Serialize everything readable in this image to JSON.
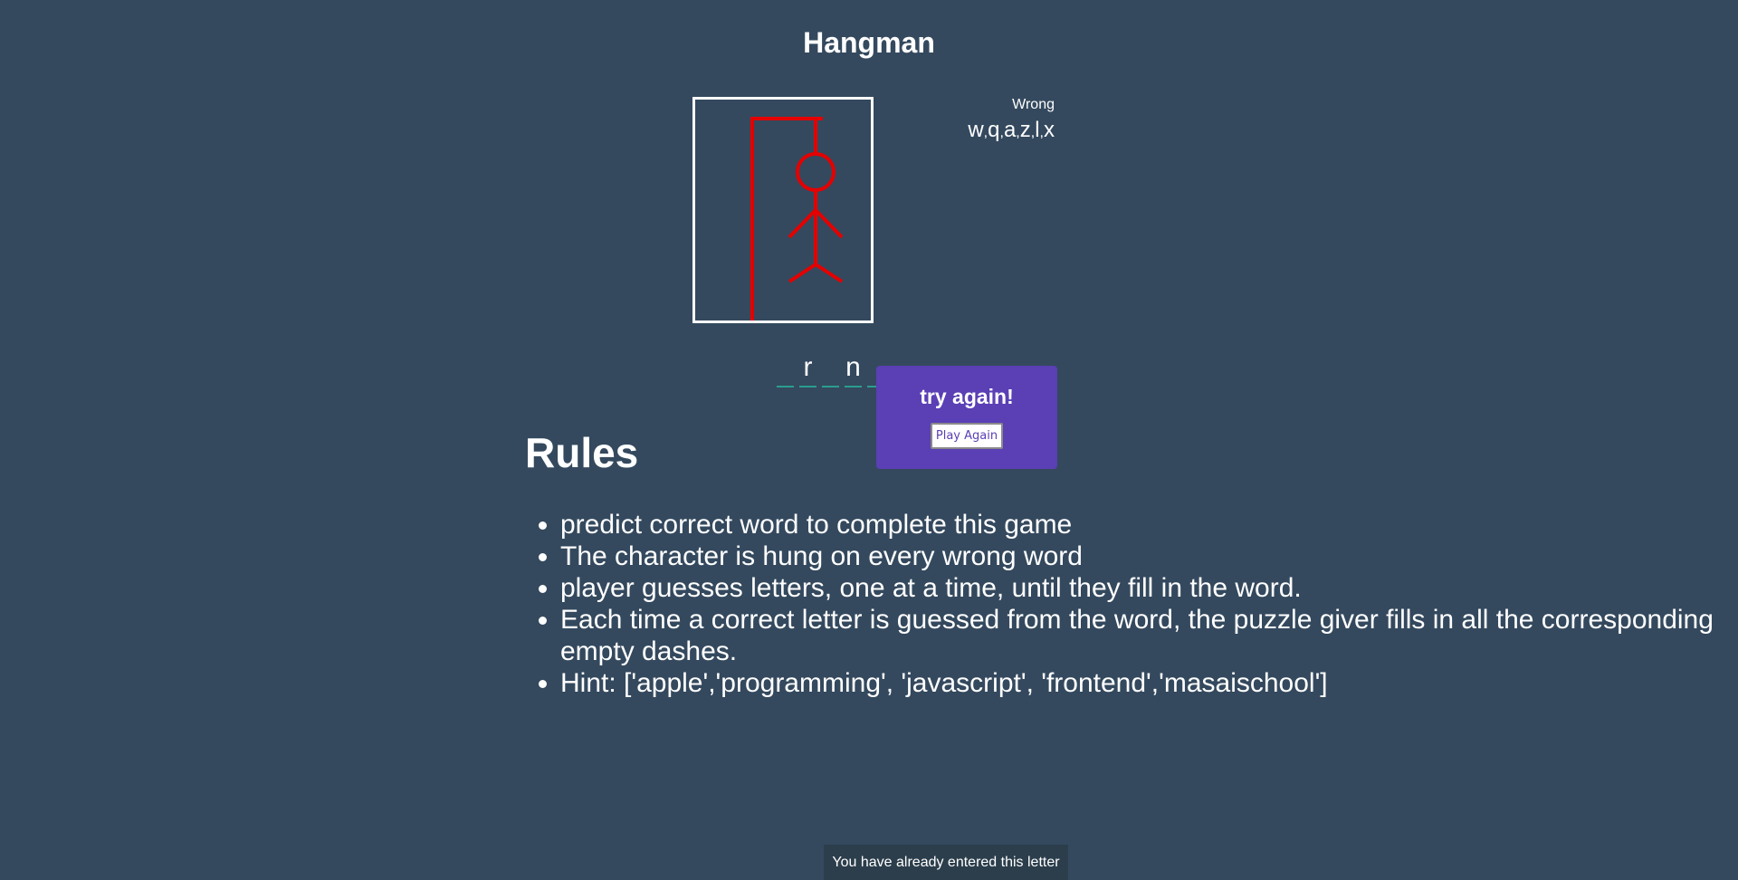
{
  "app": {
    "title": "Hangman"
  },
  "wrong": {
    "title": "Wrong",
    "letters": [
      "w",
      "q",
      "a",
      "z",
      "l",
      "x"
    ],
    "separator": ","
  },
  "word": {
    "slots": [
      "",
      "r",
      "",
      "n",
      "",
      "",
      ""
    ]
  },
  "rules": {
    "heading": "Rules",
    "items": [
      "predict correct word to complete this game",
      "The character is hung on every wrong word",
      "player guesses letters, one at a time, until they fill in the word.",
      "Each time a correct letter is guessed from the word, the puzzle giver fills in all the corresponding empty dashes.",
      "Hint: ['apple','programming', 'javascript', 'frontend','masaischool']"
    ]
  },
  "popup": {
    "message": "try again!",
    "button_label": "Play Again"
  },
  "toast": {
    "message": "You have already entered this letter"
  },
  "colors": {
    "background": "#34495e",
    "figure": "#e50000",
    "popup": "#5a3fb5",
    "slot_underline": "#2a9d8f"
  },
  "icons": {
    "hangman_figure": "hangman-figure-icon"
  }
}
